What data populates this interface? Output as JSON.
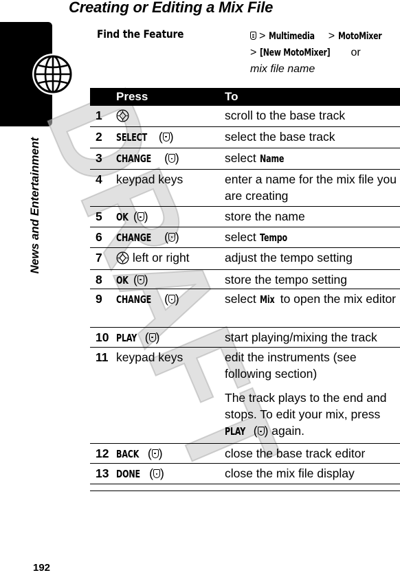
{
  "page": {
    "title": "Creating or Editing a Mix File",
    "section_label_bold": "News and",
    "section_label_light": " Entertainment",
    "page_number": "192",
    "watermark": "DRAFT"
  },
  "find_feature": {
    "label": "Find the Feature",
    "icon": "menu-key-icon",
    "sep1": ">",
    "item1": "Multimedia",
    "sep2": ">",
    "item2": "MotoMixer",
    "sep3": ">",
    "item3": "[New MotoMixer]",
    "or": "or",
    "alt": "mix file name"
  },
  "table": {
    "headers": {
      "press": "Press",
      "to": "To"
    },
    "rows": [
      {
        "num": "1",
        "press_icon": "nav-key-icon",
        "press_text": "",
        "to": "scroll to the base track"
      },
      {
        "num": "2",
        "press_key": "SELECT",
        "press_icon": "softkey-icon",
        "to": "select the base track"
      },
      {
        "num": "3",
        "press_key": "CHANGE",
        "press_icon": "softkey-icon",
        "to_pre": "select ",
        "to_kw": "Name"
      },
      {
        "num": "4",
        "press_text": "keypad keys",
        "to": "enter a name for the mix file you are creating"
      },
      {
        "num": "5",
        "press_key": "OK",
        "press_icon": "softkey-icon",
        "to": "store the name"
      },
      {
        "num": "6",
        "press_key": "CHANGE",
        "press_icon": "softkey-icon",
        "to_pre": "select ",
        "to_kw": "Tempo"
      },
      {
        "num": "7",
        "press_icon": "nav-key-icon",
        "press_text": " left or right",
        "to": "adjust the tempo setting"
      },
      {
        "num": "8",
        "press_key": "OK",
        "press_icon": "softkey-icon",
        "to": "store the tempo setting"
      },
      {
        "num": "9",
        "press_key": "CHANGE",
        "press_icon": "softkey-icon",
        "to_pre": "select ",
        "to_kw": "Mix",
        "to_post": " to open the mix editor"
      },
      {
        "num": "10",
        "press_key": "PLAY",
        "press_icon": "softkey-icon",
        "to": "start playing/mixing the track"
      },
      {
        "num": "11",
        "press_text": "keypad keys",
        "to": "edit the instruments (see following section)",
        "note_pre": "The track plays to the end and stops. To edit your mix, press ",
        "note_kw": "PLAY",
        "note_post": " again."
      },
      {
        "num": "12",
        "press_key": "BACK",
        "press_icon": "softkey-icon",
        "to": "close the base track editor"
      },
      {
        "num": "13",
        "press_key": "DONE",
        "press_icon": "softkey-icon",
        "to": "close the mix file display"
      }
    ]
  }
}
